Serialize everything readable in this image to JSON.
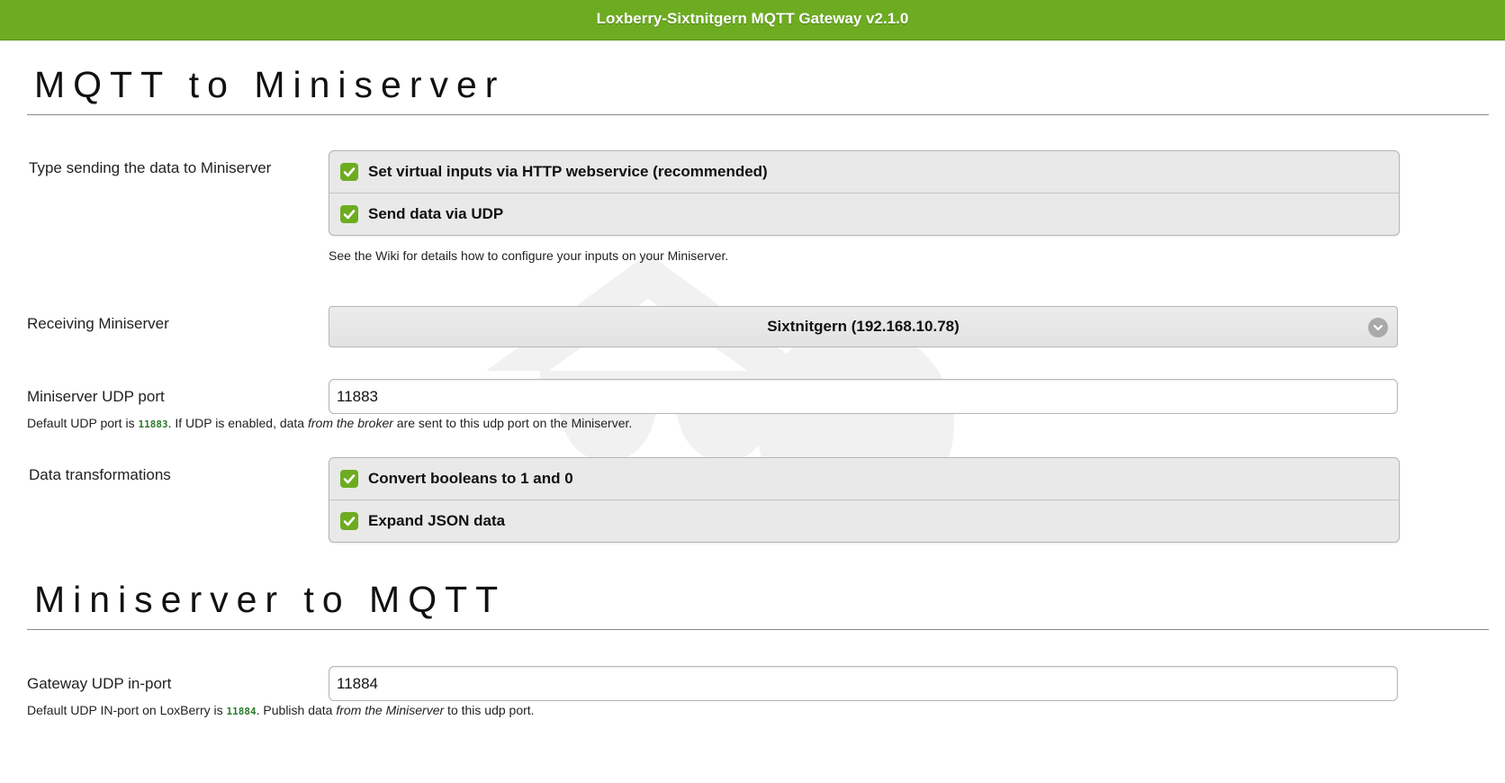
{
  "header": {
    "title": "Loxberry-Sixtnitgern MQTT Gateway v2.1.0",
    "bar_color": "#6dac21"
  },
  "section1": {
    "title": "MQTT to Miniserver",
    "send_type": {
      "label": "Type sending the data to Miniserver",
      "options": [
        {
          "label": "Set virtual inputs via HTTP webservice (recommended)",
          "checked": true
        },
        {
          "label": "Send data via UDP",
          "checked": true
        }
      ],
      "hint": "See the Wiki for details how to configure your inputs on your Miniserver."
    },
    "receiving_miniserver": {
      "label": "Receiving Miniserver",
      "selected": "Sixtnitgern (192.168.10.78)"
    },
    "udp_port": {
      "label": "Miniserver UDP port",
      "value": "11883",
      "hint_prefix": "Default UDP port is ",
      "hint_code": "11883",
      "hint_mid": ". If UDP is enabled, data ",
      "hint_em": "from the broker",
      "hint_suffix": " are sent to this udp port on the Miniserver."
    },
    "transformations": {
      "label": "Data transformations",
      "options": [
        {
          "label": "Convert booleans to 1 and 0",
          "checked": true
        },
        {
          "label": "Expand JSON data",
          "checked": true
        }
      ]
    }
  },
  "section2": {
    "title": "Miniserver to MQTT",
    "udp_in_port": {
      "label": "Gateway UDP in-port",
      "value": "11884",
      "hint_prefix": "Default UDP IN-port on LoxBerry is ",
      "hint_code": "11884",
      "hint_mid": ". Publish data ",
      "hint_em": "from the Miniserver",
      "hint_suffix": " to this udp port."
    }
  }
}
